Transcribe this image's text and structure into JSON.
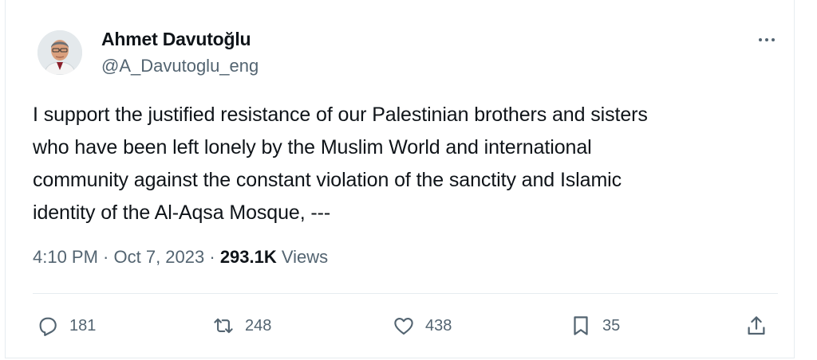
{
  "tweet": {
    "author": {
      "name": "Ahmet Davutoğlu",
      "handle": "@A_Davutoglu_eng",
      "avatar": "avatar-photo"
    },
    "more_icon": "more-horizontal-icon",
    "text": "I support the justified resistance of our Palestinian brothers and sisters\nwho have been left lonely  by the Muslim World and international\ncommunity against the constant violation of the sanctity and Islamic\nidentity of the Al-Aqsa Mosque, ---",
    "meta": {
      "time": "4:10 PM",
      "sep1": " · ",
      "date": "Oct 7, 2023",
      "sep2": " · ",
      "views_count": "293.1K",
      "views_label": " Views"
    },
    "actions": {
      "reply": {
        "icon": "reply-icon",
        "count": "181"
      },
      "retweet": {
        "icon": "retweet-icon",
        "count": "248"
      },
      "like": {
        "icon": "heart-icon",
        "count": "438"
      },
      "bookmark": {
        "icon": "bookmark-icon",
        "count": "35"
      },
      "share": {
        "icon": "share-icon"
      }
    }
  },
  "colors": {
    "text": "#0f1419",
    "secondary": "#536471",
    "border": "#e6ecf0"
  }
}
